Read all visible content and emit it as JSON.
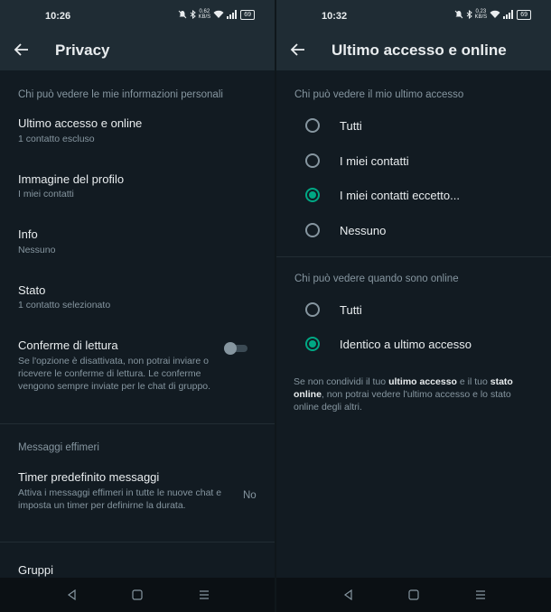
{
  "left": {
    "status": {
      "time": "10:26",
      "net_speed_top": "0.62",
      "net_speed_unit": "KB/S",
      "battery": "69"
    },
    "title": "Privacy",
    "section_personal": "Chi può vedere le mie informazioni personali",
    "rows": [
      {
        "title": "Ultimo accesso e online",
        "subtitle": "1 contatto escluso"
      },
      {
        "title": "Immagine del profilo",
        "subtitle": "I miei contatti"
      },
      {
        "title": "Info",
        "subtitle": "Nessuno"
      },
      {
        "title": "Stato",
        "subtitle": "1 contatto selezionato"
      }
    ],
    "read_receipts": {
      "title": "Conferme di lettura",
      "desc": "Se l'opzione è disattivata, non potrai inviare o ricevere le conferme di lettura. Le conferme vengono sempre inviate per le chat di gruppo.",
      "enabled": false
    },
    "section_ephemeral": "Messaggi effimeri",
    "timer": {
      "title": "Timer predefinito messaggi",
      "desc": "Attiva i messaggi effimeri in tutte le nuove chat e imposta un timer per definirne la durata.",
      "value": "No"
    },
    "groups_title": "Gruppi"
  },
  "right": {
    "status": {
      "time": "10:32",
      "net_speed_top": "0.23",
      "net_speed_unit": "KB/S",
      "battery": "69"
    },
    "title": "Ultimo accesso e online",
    "section_last_seen": "Chi può vedere il mio ultimo accesso",
    "last_seen_options": [
      {
        "label": "Tutti",
        "selected": false
      },
      {
        "label": "I miei contatti",
        "selected": false
      },
      {
        "label": "I miei contatti eccetto...",
        "selected": true
      },
      {
        "label": "Nessuno",
        "selected": false
      }
    ],
    "section_online": "Chi può vedere quando sono online",
    "online_options": [
      {
        "label": "Tutti",
        "selected": false
      },
      {
        "label": "Identico a ultimo accesso",
        "selected": true
      }
    ],
    "note": {
      "part1": "Se non condividi il tuo ",
      "bold1": "ultimo accesso",
      "part2": " e il tuo ",
      "bold2": "stato online",
      "part3": ", non potrai vedere l'ultimo accesso e lo stato online degli altri."
    }
  },
  "colors": {
    "background": "#121b22",
    "appbar": "#1f2c34",
    "accent": "#00a884",
    "secondary_text": "#8696a0",
    "primary_text": "#e9edef"
  },
  "icons": [
    "back-arrow-icon",
    "mute-icon",
    "bluetooth-icon",
    "wifi-icon",
    "signal-icon",
    "battery-icon",
    "nav-back-icon",
    "nav-home-icon",
    "nav-recents-icon"
  ]
}
